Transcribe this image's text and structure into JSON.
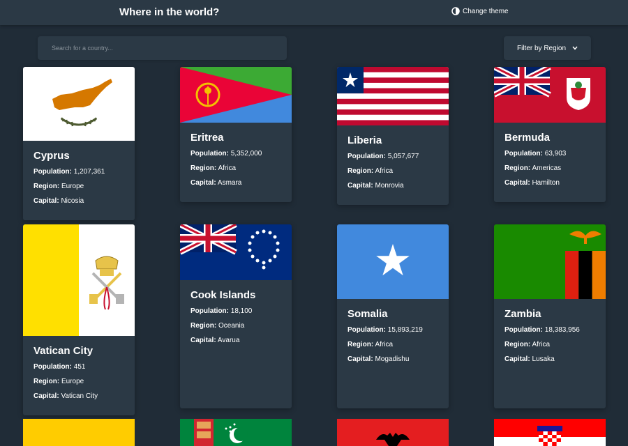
{
  "header": {
    "title": "Where in the world?",
    "theme_label": "Change theme",
    "theme_icon": "half-moon-icon"
  },
  "search": {
    "placeholder": "Search for a country..."
  },
  "filter": {
    "label": "Filter by Region",
    "icon": "chevron-down-icon"
  },
  "labels": {
    "population": "Population:",
    "region": "Region:",
    "capital": "Capital:"
  },
  "countries": [
    {
      "name": "Cyprus",
      "population": "1,207,361",
      "region": "Europe",
      "capital": "Nicosia"
    },
    {
      "name": "Eritrea",
      "population": "5,352,000",
      "region": "Africa",
      "capital": "Asmara"
    },
    {
      "name": "Liberia",
      "population": "5,057,677",
      "region": "Africa",
      "capital": "Monrovia"
    },
    {
      "name": "Bermuda",
      "population": "63,903",
      "region": "Americas",
      "capital": "Hamilton"
    },
    {
      "name": "Vatican City",
      "population": "451",
      "region": "Europe",
      "capital": "Vatican City"
    },
    {
      "name": "Cook Islands",
      "population": "18,100",
      "region": "Oceania",
      "capital": "Avarua"
    },
    {
      "name": "Somalia",
      "population": "15,893,219",
      "region": "Africa",
      "capital": "Mogadishu"
    },
    {
      "name": "Zambia",
      "population": "18,383,956",
      "region": "Africa",
      "capital": "Lusaka"
    }
  ],
  "colors": {
    "background": "#202c37",
    "elements": "#2b3945",
    "text": "#ffffff"
  }
}
